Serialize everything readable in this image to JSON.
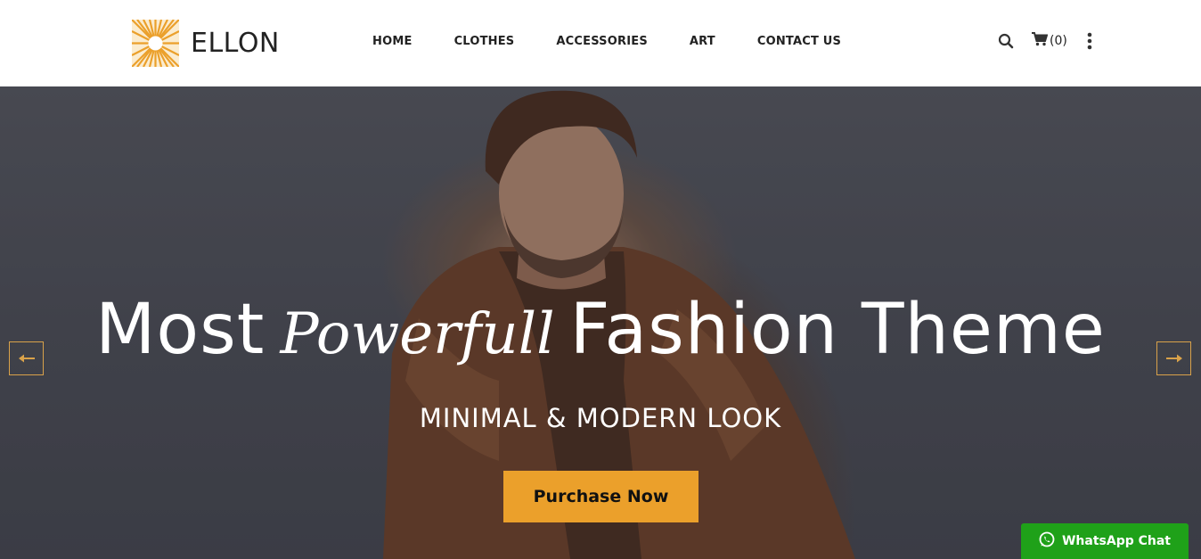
{
  "brand": {
    "name": "ELLON",
    "logo_icon": "sunburst-logo-icon",
    "accent_color": "#eba02b"
  },
  "nav": {
    "items": [
      {
        "label": "HOME"
      },
      {
        "label": "CLOTHES"
      },
      {
        "label": "ACCESSORIES"
      },
      {
        "label": "ART"
      },
      {
        "label": "CONTACT US"
      }
    ]
  },
  "tools": {
    "search_icon": "search-icon",
    "cart_icon": "cart-icon",
    "cart_count": "(0)",
    "menu_icon": "more-vertical-icon"
  },
  "hero": {
    "headline_start": "Most",
    "headline_script": "Powerfull",
    "headline_end": "Fashion Theme",
    "subheadline": "MINIMAL & MODERN LOOK",
    "cta_label": "Purchase Now",
    "prev_icon": "arrow-left-icon",
    "next_icon": "arrow-right-icon"
  },
  "whatsapp": {
    "label": "WhatsApp Chat",
    "icon": "whatsapp-icon",
    "color": "#1fa119"
  }
}
